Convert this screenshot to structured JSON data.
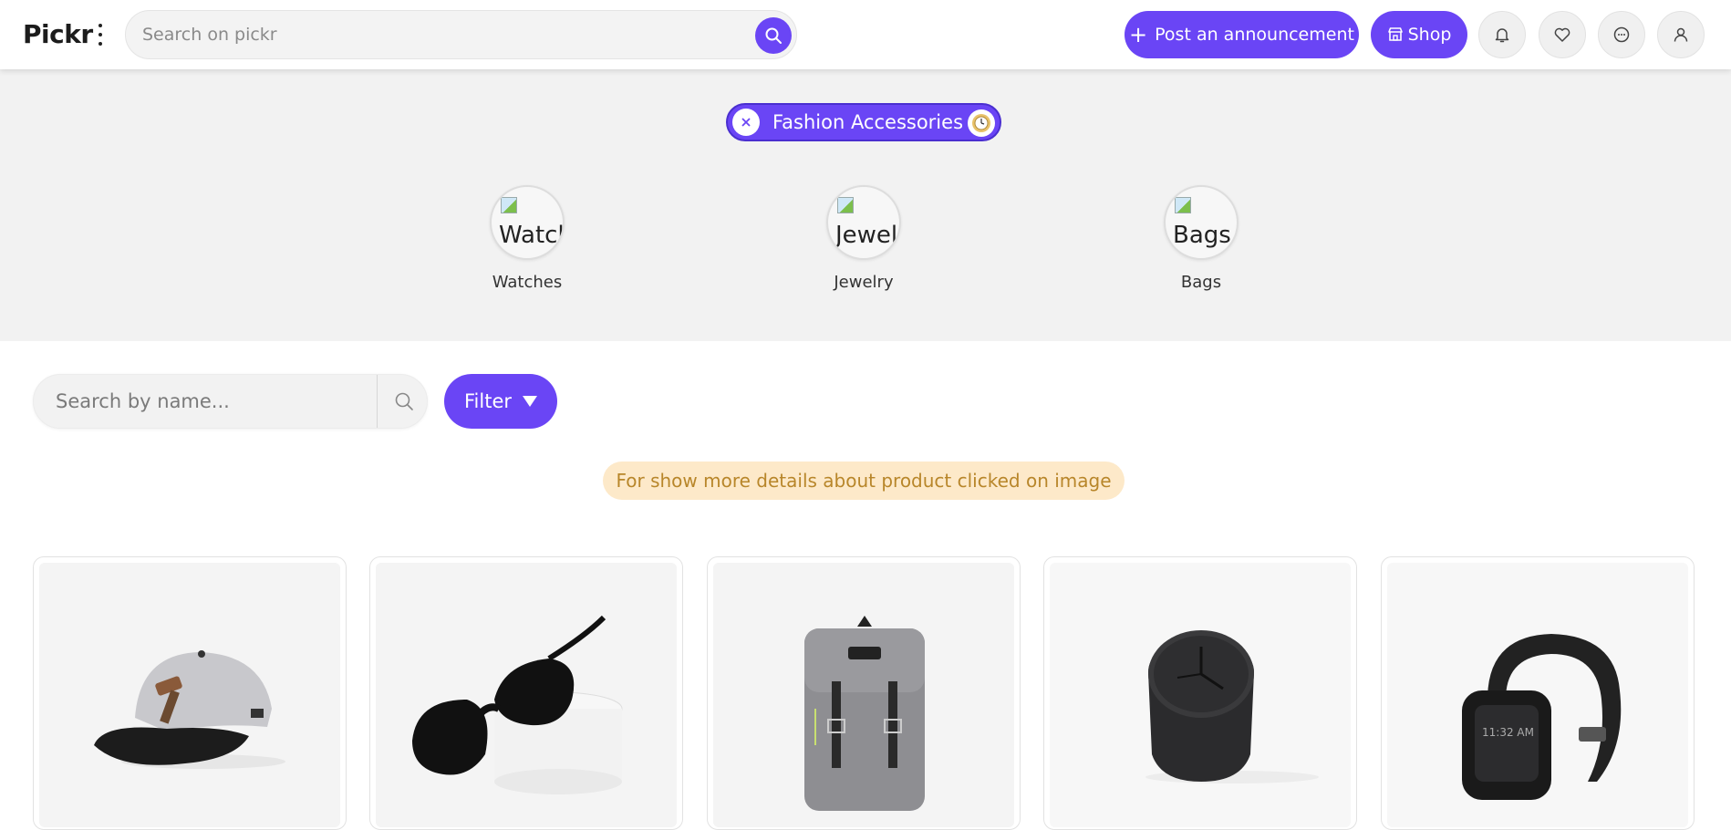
{
  "header": {
    "logo": "Pickr",
    "search_placeholder": "Search on pickr",
    "post_label": "Post an announcement",
    "shop_label": "Shop"
  },
  "category": {
    "selected": "Fashion Accessories",
    "subcategories": [
      {
        "label": "Watches",
        "alt": "Watches"
      },
      {
        "label": "Jewelry",
        "alt": "Jewelry"
      },
      {
        "label": "Bags",
        "alt": "Bags"
      }
    ]
  },
  "list": {
    "search_placeholder": "Search by name...",
    "filter_label": "Filter",
    "notice": "For show more details about product clicked on image"
  },
  "products": [
    {
      "icon": "cap-image"
    },
    {
      "icon": "sunglasses-image"
    },
    {
      "icon": "backpack-image"
    },
    {
      "icon": "desk-clock-image"
    },
    {
      "icon": "fitness-band-image"
    }
  ],
  "colors": {
    "accent": "#6a45f5",
    "notice_bg": "#fde9c9",
    "notice_text": "#b8862a"
  }
}
